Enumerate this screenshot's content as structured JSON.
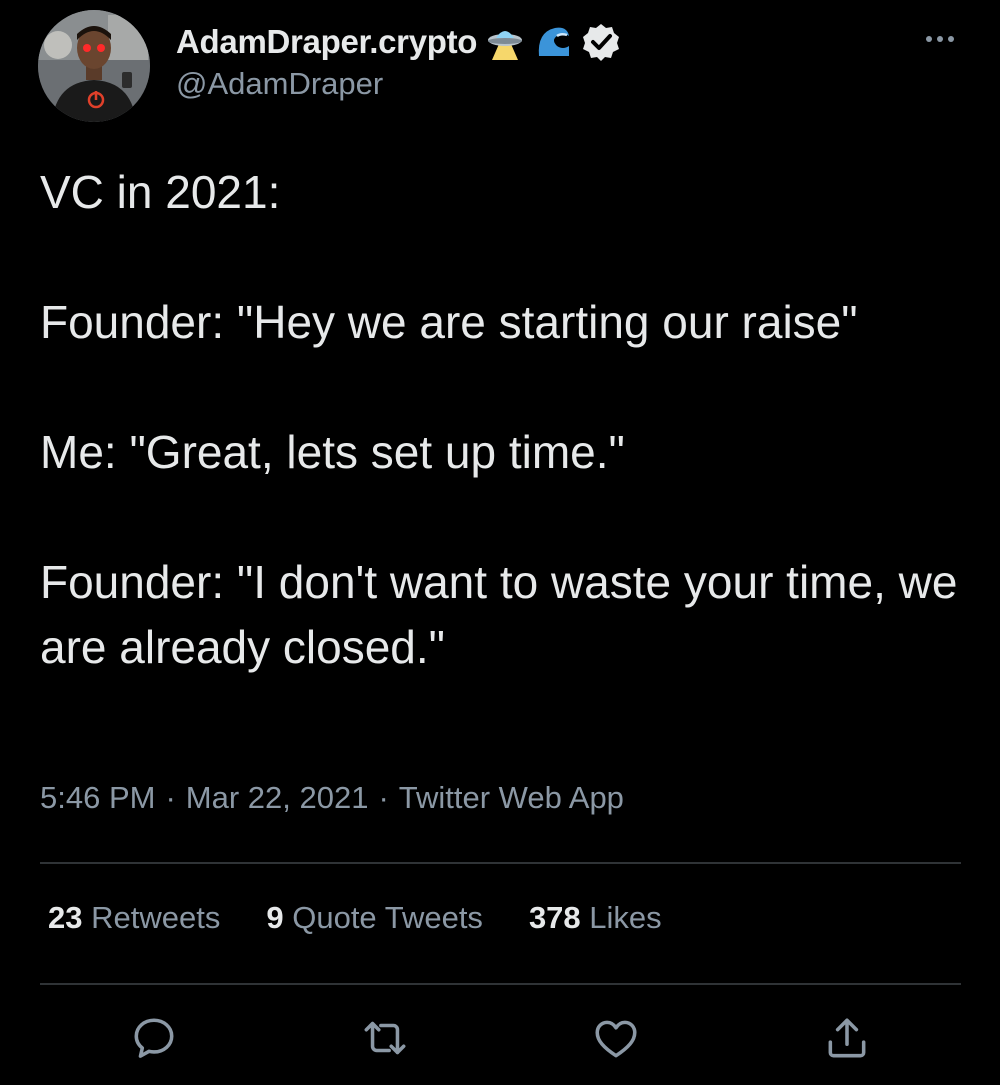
{
  "author": {
    "display_name": "AdamDraper.crypto",
    "handle": "@AdamDraper",
    "verified": true,
    "name_emojis": [
      "ufo-emoji",
      "wave-emoji"
    ]
  },
  "tweet": {
    "paragraphs": [
      "VC in 2021:",
      "Founder: \"Hey we are starting our raise\"",
      "Me: \"Great, lets set up time.\"",
      "Founder: \"I don't want to waste your time, we are already closed.\""
    ],
    "time": "5:46 PM",
    "date": "Mar 22, 2021",
    "source": "Twitter Web App",
    "separator": "·"
  },
  "stats": {
    "retweets_count": "23",
    "retweets_label": "Retweets",
    "quotes_count": "9",
    "quotes_label": "Quote Tweets",
    "likes_count": "378",
    "likes_label": "Likes"
  },
  "actions": [
    "reply-icon",
    "retweet-icon",
    "like-icon",
    "share-icon"
  ],
  "colors": {
    "background": "#000000",
    "text": "#e7e9ea",
    "secondary_text": "#8b98a5",
    "divider": "#2f3336"
  }
}
